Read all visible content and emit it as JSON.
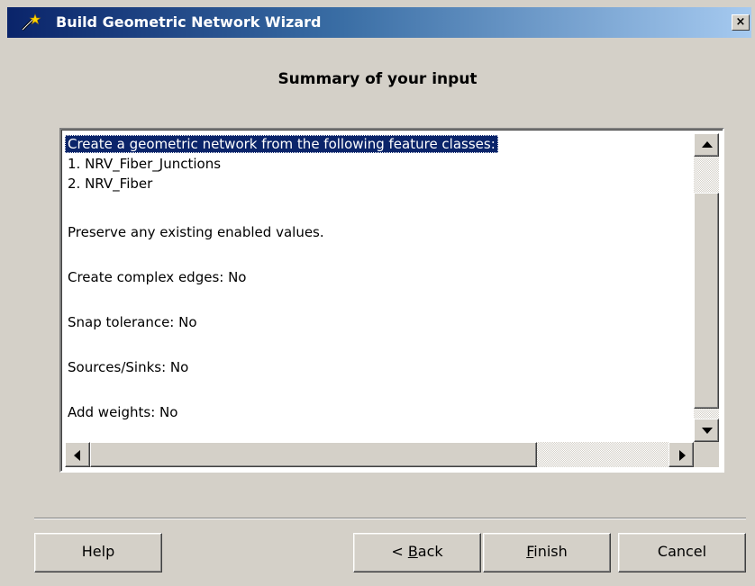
{
  "window": {
    "title": "Build Geometric Network Wizard",
    "close_glyph": "×",
    "icon": "wizard-wand-icon"
  },
  "heading": "Summary of your input",
  "summary": {
    "lines": [
      "Create a geometric network from the following feature classes:",
      "1. NRV_Fiber_Junctions",
      "2. NRV_Fiber",
      "Preserve any existing enabled values.",
      "Create complex edges: No",
      "Snap tolerance: No",
      "Sources/Sinks: No",
      "Add weights: No"
    ],
    "selected_index": 0
  },
  "buttons": {
    "help": "Help",
    "back": "< Back",
    "back_mnemonic": "B",
    "finish": "Finish",
    "finish_mnemonic": "F",
    "cancel": "Cancel"
  },
  "colors": {
    "selection": "#0a246a",
    "face": "#d4d0c8",
    "title_gradient_start": "#0a246a",
    "title_gradient_end": "#a6caf0"
  }
}
